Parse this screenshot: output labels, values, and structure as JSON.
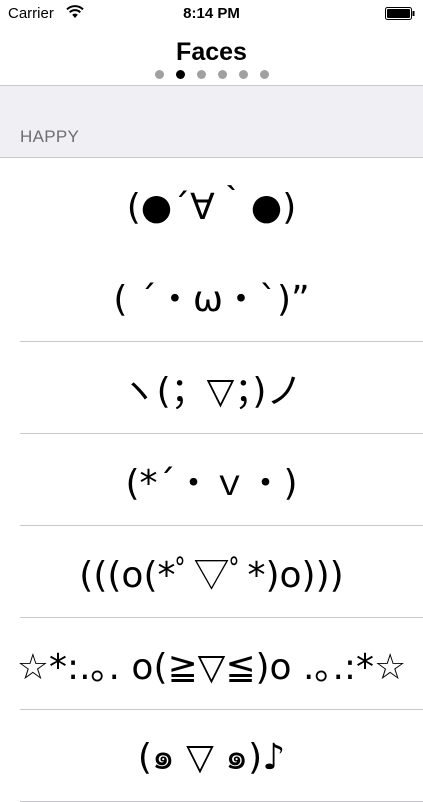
{
  "status_bar": {
    "carrier": "Carrier",
    "time": "8:14 PM"
  },
  "nav": {
    "title": "Faces",
    "page_count": 6,
    "active_page": 1
  },
  "section": {
    "header": "HAPPY"
  },
  "faces": [
    "(●´∀｀●)",
    "( ´・ω・`)”",
    "ヽ(；▽；)ノ",
    "(*´・ｖ・)",
    "(((o(*ﾟ▽ﾟ*)o)))",
    "☆*:.｡. o(≧▽≦)o .｡.:*☆",
    "(๑ ▽ ๑)♪"
  ],
  "colors": {
    "background": "#ffffff",
    "section_background": "#efeff4",
    "separator": "#c8c7cc",
    "section_text": "#6d6d72"
  }
}
